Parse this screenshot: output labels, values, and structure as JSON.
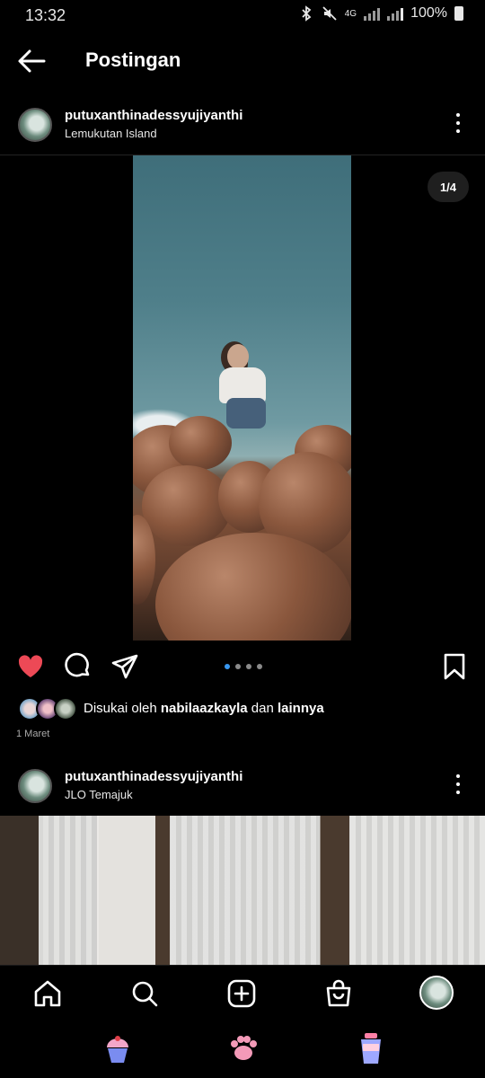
{
  "status_bar": {
    "time": "13:32",
    "network": "4G",
    "battery": "100%"
  },
  "header": {
    "title": "Postingan"
  },
  "post1": {
    "username": "putuxanthinadessyujiyanthi",
    "location": "Lemukutan Island",
    "image_counter": "1/4",
    "liked_prefix": "Disukai oleh",
    "liked_user": "nabilaazkayla",
    "liked_connector": "dan",
    "liked_suffix": "lainnya",
    "date": "1 Maret",
    "carousel_count": 4,
    "carousel_active_index": 0
  },
  "post2": {
    "username": "putuxanthinadessyujiyanthi",
    "location": "JLO Temajuk"
  },
  "icons": {
    "back": "arrow-left-icon",
    "more": "more-vertical-icon",
    "like": "heart-filled-icon",
    "comment": "comment-icon",
    "share": "send-icon",
    "save": "bookmark-icon",
    "nav": [
      "home-icon",
      "search-icon",
      "add-post-icon",
      "shop-icon",
      "profile-avatar"
    ],
    "system": [
      "cupcake-icon",
      "paw-icon",
      "cup-icon"
    ]
  },
  "colors": {
    "background": "#000000",
    "like_red": "#ed4956",
    "carousel_active": "#3897f0"
  }
}
